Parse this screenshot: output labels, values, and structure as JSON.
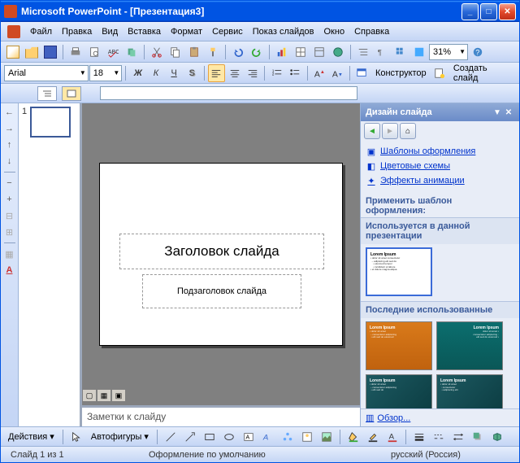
{
  "titlebar": {
    "app_name": "Microsoft PowerPoint",
    "doc_name": "- [Презентация3]"
  },
  "menu": {
    "file": "Файл",
    "edit": "Правка",
    "view": "Вид",
    "insert": "Вставка",
    "format": "Формат",
    "tools": "Сервис",
    "slideshow": "Показ слайдов",
    "window": "Окно",
    "help": "Справка"
  },
  "toolbar": {
    "zoom": "31%"
  },
  "format_toolbar": {
    "font_name": "Arial",
    "font_size": "18",
    "bold": "Ж",
    "italic": "К",
    "underline": "Ч",
    "shadow": "S",
    "designer": "Конструктор",
    "new_slide": "Создать слайд"
  },
  "slide": {
    "title_placeholder": "Заголовок слайда",
    "subtitle_placeholder": "Подзаголовок слайда"
  },
  "thumbnail": {
    "number": "1"
  },
  "notes": {
    "placeholder": "Заметки к слайду"
  },
  "taskpane": {
    "title": "Дизайн слайда",
    "link_templates": "Шаблоны оформления",
    "link_colors": "Цветовые схемы",
    "link_animation": "Эффекты анимации",
    "apply_title": "Применить шаблон оформления:",
    "used_header": "Используется в данной презентации",
    "recent_header": "Последние использованные",
    "browse": "Обзор..."
  },
  "bottom_toolbar": {
    "actions": "Действия",
    "autoshapes": "Автофигуры"
  },
  "statusbar": {
    "slide_info": "Слайд 1 из 1",
    "design": "Оформление по умолчанию",
    "language": "русский (Россия)"
  }
}
